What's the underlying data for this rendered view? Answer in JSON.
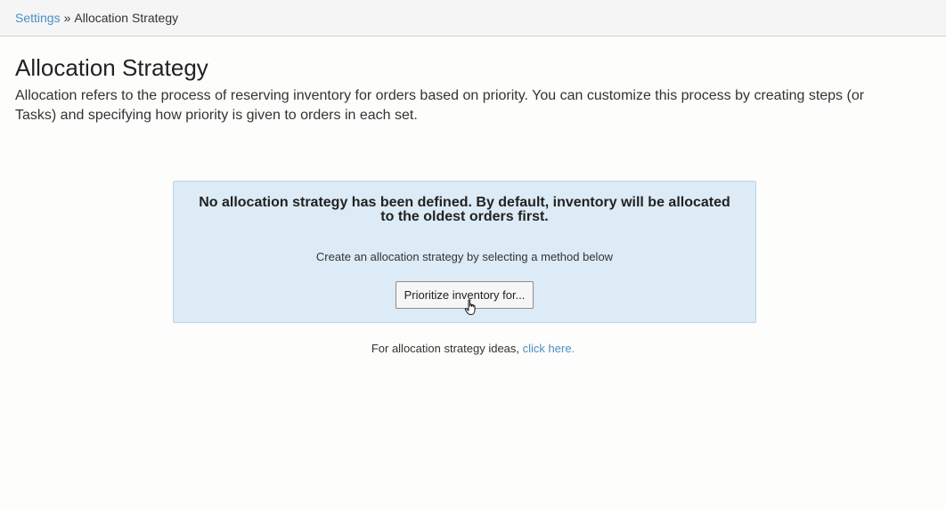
{
  "breadcrumb": {
    "parent_label": "Settings",
    "separator": "»",
    "current_label": "Allocation Strategy"
  },
  "page": {
    "title": "Allocation Strategy",
    "description": "Allocation refers to the process of reserving inventory for orders based on priority. You can customize this process by creating steps (or Tasks) and specifying how priority is given to orders in each set."
  },
  "notice": {
    "heading": "No allocation strategy has been defined. By default, inventory will be allocated to the oldest orders first.",
    "subtext": "Create an allocation strategy by selecting a method below",
    "button_label": "Prioritize inventory for..."
  },
  "ideas": {
    "text": "For allocation strategy ideas, ",
    "link_label": "click here."
  },
  "colors": {
    "link": "#4a90c2",
    "notice_bg": "#dcebf6",
    "notice_border": "#b8d4e8"
  },
  "icons": {
    "cursor": "hand-pointer-cursor-icon"
  }
}
